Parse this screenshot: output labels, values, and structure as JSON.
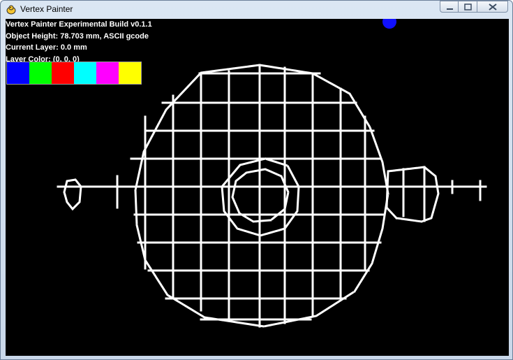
{
  "window": {
    "title": "Vertex Painter"
  },
  "info": {
    "build": "Vertex Painter Experimental Build v0.1.1",
    "object_height": "Object Height: 78.703 mm, ASCII gcode",
    "current_layer": "Current Layer: 0.0 mm",
    "layer_color": "Layer Color: (0, 0, 0)"
  },
  "palette": {
    "colors": [
      "#0000ff",
      "#00ff00",
      "#ff0000",
      "#00ffff",
      "#ff00ff",
      "#ffff00"
    ]
  },
  "icons": {
    "app": "pygame-snake-icon",
    "minimize": "minimize-icon",
    "maximize": "maximize-icon",
    "close": "close-icon",
    "cursor": "brush-cursor-dot"
  },
  "colors": {
    "canvas_bg": "#000000",
    "model_lines": "#ffffff",
    "cursor": "#1010ff"
  }
}
